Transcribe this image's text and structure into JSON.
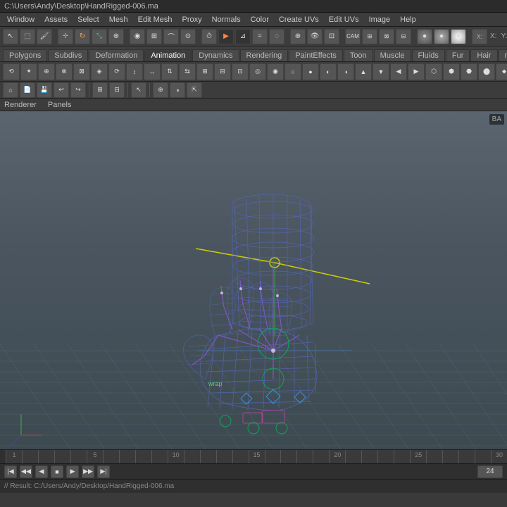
{
  "titleBar": {
    "text": "C:\\Users\\Andy\\Desktop\\HandRigged-006.ma"
  },
  "menuBar": {
    "items": [
      "Window",
      "Assets",
      "Select",
      "Mesh",
      "Edit Mesh",
      "Proxy",
      "Normals",
      "Color",
      "Create UVs",
      "Edit UVs",
      "Image",
      "Help"
    ]
  },
  "toolbar1": {
    "buttons": [
      "arrow",
      "lasso",
      "paint",
      "move",
      "rotate",
      "scale",
      "uni",
      "snap-grid",
      "snap-curve",
      "snap-point",
      "snap-surface",
      "snap-live",
      "magnet",
      "soft-select",
      "history",
      "wrap",
      "bevel",
      "crease",
      "edge",
      "face",
      "vertex",
      "extrude",
      "bridge",
      "wedge",
      "poke",
      "insert-edge",
      "delete-edge",
      "merge",
      "collapse",
      "spin",
      "flip",
      "mirror",
      "split",
      "cut",
      "offset",
      "chamfer",
      "fill",
      "edit-flow",
      "smooth",
      "average",
      "relax",
      "sculpt"
    ]
  },
  "shelfTabs": {
    "tabs": [
      "Polygons",
      "Subdivs",
      "Deformation",
      "Animation",
      "Dynamics",
      "Rendering",
      "PaintEffects",
      "Toon",
      "Muscle",
      "Fluids",
      "Fur",
      "Hair",
      "nCloth"
    ],
    "activeTab": "Animation"
  },
  "shelfIcons": {
    "count": 40
  },
  "extraToolbar": {
    "buttons": [
      "renderer",
      "panels",
      "layout",
      "grid",
      "undo",
      "redo"
    ]
  },
  "rendererPanels": {
    "renderer": "Renderer",
    "panels": "Panels"
  },
  "viewport": {
    "panelLabel": "BA",
    "wrapLabel": "wrap"
  },
  "timeline": {
    "ticks": [
      "1",
      "",
      "",
      "",
      "",
      "5",
      "",
      "",
      "",
      "",
      "10",
      "",
      "",
      "",
      "",
      "15",
      "",
      "",
      "",
      "",
      "20",
      "",
      "",
      "",
      "",
      "25",
      "",
      "",
      "",
      "",
      "30"
    ],
    "minorTicks": 30,
    "currentFrame": "24"
  },
  "statusBar": {
    "result": "// Result: C:/Users/Andy/Desktop/HandRigged-006.ma"
  },
  "colors": {
    "wireframe": "#5566bb",
    "skeleton": "#6644aa",
    "background_top": "#5a6570",
    "background_bottom": "#3d4a50",
    "grid": "#555566",
    "axis_x": "#cc4444",
    "axis_y": "#44cc44",
    "axis_z": "#4444cc",
    "rotate_handle": "#cccc00",
    "green_circle": "#00bb00"
  }
}
